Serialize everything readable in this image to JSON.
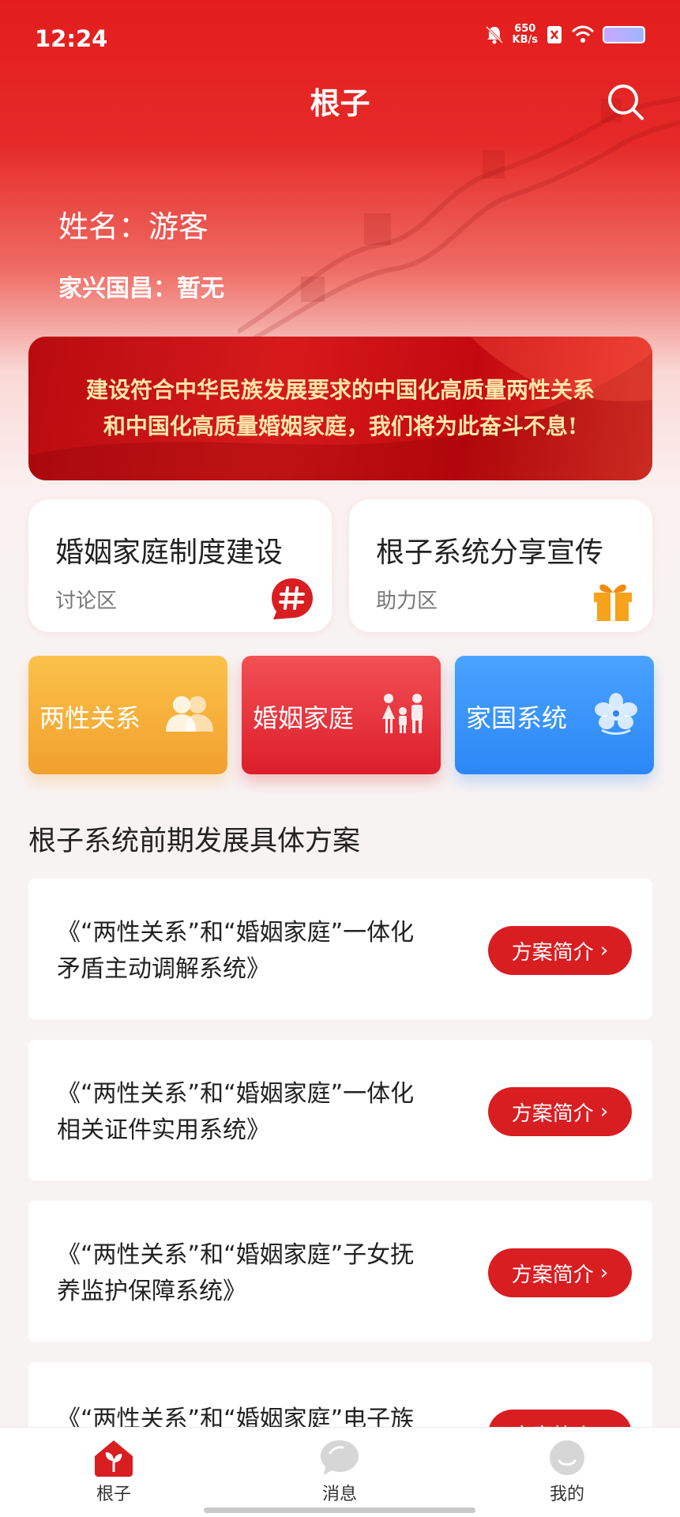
{
  "status_bar": {
    "time": "12:24",
    "net_speed_value": "650",
    "net_speed_unit": "KB/s"
  },
  "header": {
    "title": "根子"
  },
  "profile": {
    "name_line": "姓名：游客",
    "slogan_line": "家兴国昌：暂无"
  },
  "banner": {
    "line1": "建设符合中华民族发展要求的中国化高质量两性关系",
    "line2": "和中国化高质量婚姻家庭，我们将为此奋斗不息!"
  },
  "cards": [
    {
      "title": "婚姻家庭制度建设",
      "subtitle": "讨论区",
      "icon": "hash-chat-icon"
    },
    {
      "title": "根子系统分享宣传",
      "subtitle": "助力区",
      "icon": "gift-icon"
    }
  ],
  "tiles": [
    {
      "label": "两性关系",
      "icon": "couple-icon",
      "color": "#f2a02d"
    },
    {
      "label": "婚姻家庭",
      "icon": "family-icon",
      "color": "#dc1e2b"
    },
    {
      "label": "家国系统",
      "icon": "flower-emblem-icon",
      "color": "#2b87f5"
    }
  ],
  "section": {
    "title": "根子系统前期发展具体方案"
  },
  "plans": [
    {
      "line1": "《“两性关系”和“婚姻家庭”一体化",
      "line2": "矛盾主动调解系统》",
      "button": "方案简介"
    },
    {
      "line1": "《“两性关系”和“婚姻家庭”一体化",
      "line2": "相关证件实用系统》",
      "button": "方案简介"
    },
    {
      "line1": "《“两性关系”和“婚姻家庭”子女抚",
      "line2": "养监护保障系统》",
      "button": "方案简介"
    },
    {
      "line1": "《“两性关系”和“婚姻家庭”电子族",
      "line2": "",
      "button": "方案简介"
    }
  ],
  "tabbar": {
    "tabs": [
      {
        "label": "根子",
        "icon": "sprout-home-icon",
        "active": true
      },
      {
        "label": "消息",
        "icon": "chat-bubble-icon",
        "active": false
      },
      {
        "label": "我的",
        "icon": "smile-face-icon",
        "active": false
      }
    ]
  },
  "colors": {
    "brand_red": "#e31d1d",
    "button_red": "#d91e22",
    "banner_text": "#fde7a8"
  }
}
